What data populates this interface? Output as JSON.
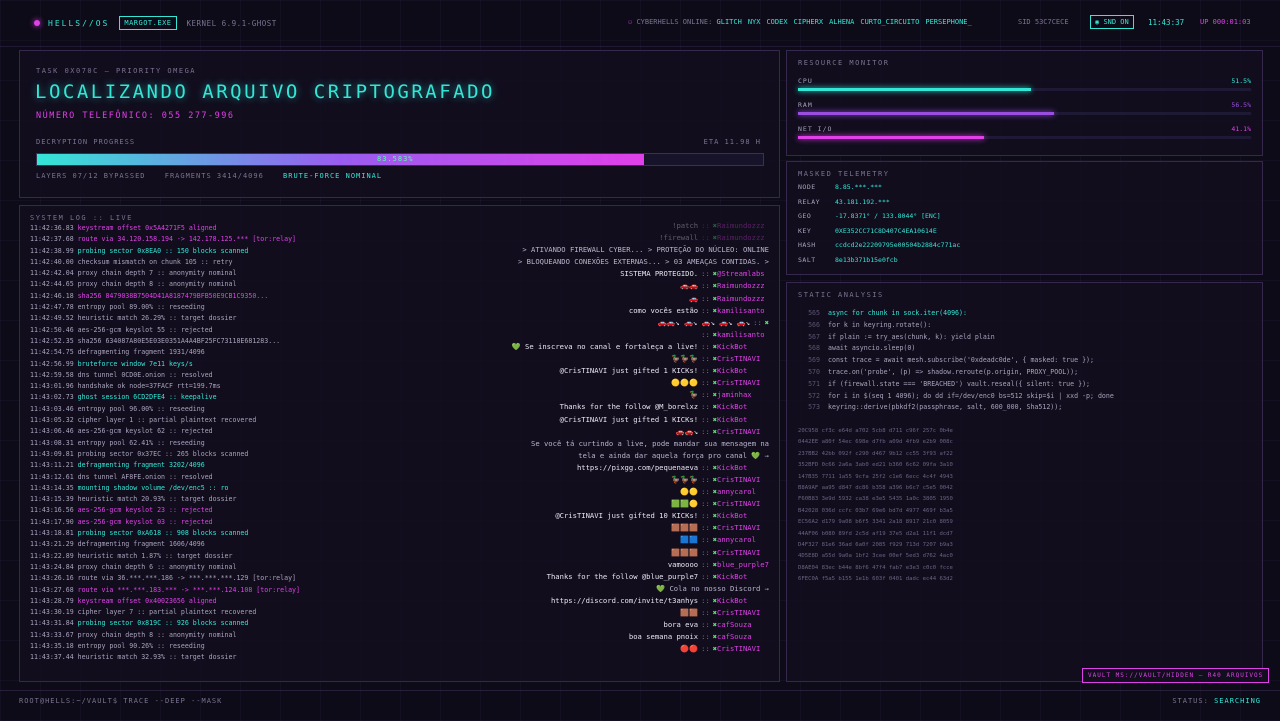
{
  "topbar": {
    "brand": "HELLS//OS",
    "process_badge": "MARGOT.EXE",
    "kernel": "KERNEL 6.9.1-GHOST",
    "online_label": "CYBERHELLS ONLINE:",
    "online_users": [
      "GLITCH",
      "NYX",
      "CODEX",
      "CIPHERX",
      "ALHENA",
      "CURTO_CIRCUITO",
      "PERSEPHONE_"
    ],
    "sid": "SID 53C7CECE",
    "snd_button": "SND ON",
    "clock": "11:43:37",
    "uptime": "UP 000:01:03"
  },
  "main": {
    "task": "TASK 0X070C — PRIORITY OMEGA",
    "headline": "LOCALIZANDO ARQUIVO CRIPTOGRAFADO",
    "phone": "NÚMERO TELEFÔNICO: 055 277-996",
    "progress_label": "DECRYPTION PROGRESS",
    "eta": "ETA 11.98 H",
    "progress_text": "83.583%",
    "progress_fraction": 0.836,
    "layers": "LAYERS 07/12 BYPASSED",
    "fragments": "FRAGMENTS 3414/4096",
    "status": "BRUTE-FORCE NOMINAL"
  },
  "log": {
    "title": "SYSTEM LOG :: LIVE",
    "lines": [
      {
        "t": "11:42:36.83",
        "msg": "keystream offset 0x5A4271F5 aligned",
        "color": "mag"
      },
      {
        "t": "11:42:37.68",
        "msg": "route via 34.120.158.194 -> 142.178.125.*** [tor:relay]",
        "color": "mag"
      },
      {
        "t": "11:42:38.99",
        "msg": "probing sector 0x8EA0 :: 150 blocks scanned",
        "color": "cyan"
      },
      {
        "t": "11:42:40.00",
        "msg": "checksum mismatch on chunk 105 :: retry",
        "color": ""
      },
      {
        "t": "11:42:42.04",
        "msg": "proxy chain depth 7 :: anonymity nominal",
        "color": ""
      },
      {
        "t": "11:42:44.65",
        "msg": "proxy chain depth 8 :: anonymity nominal",
        "color": ""
      },
      {
        "t": "11:42:46.18",
        "msg": "sha256 8479038B7504D41A8187479BFB50E9CB1C9350...",
        "color": "mag"
      },
      {
        "t": "11:42:47.78",
        "msg": "entropy pool 89.00% :: reseeding",
        "color": ""
      },
      {
        "t": "11:42:49.52",
        "msg": "heuristic match 26.29% :: target dossier",
        "color": ""
      },
      {
        "t": "11:42:50.46",
        "msg": "aes-256-gcm keyslot 55 :: rejected",
        "color": ""
      },
      {
        "t": "11:42:52.35",
        "msg": "sha256 634087A80E5E03E0351A4A4BF25FC73118E681283...",
        "color": ""
      },
      {
        "t": "11:42:54.75",
        "msg": "defragmenting fragment 1931/4096",
        "color": ""
      },
      {
        "t": "11:42:56.99",
        "msg": "bruteforce window 7e11 keys/s",
        "color": "cyan"
      },
      {
        "t": "11:42:59.58",
        "msg": "dns tunnel 0CD0E.onion :: resolved",
        "color": ""
      },
      {
        "t": "11:43:01.96",
        "msg": "handshake ok node=37FACF rtt=199.7ms",
        "color": ""
      },
      {
        "t": "11:43:02.73",
        "msg": "ghost session 6CD2DFE4 :: keepalive",
        "color": "cyan"
      },
      {
        "t": "11:43:03.46",
        "msg": "entropy pool 96.00% :: reseeding",
        "color": ""
      },
      {
        "t": "11:43:05.32",
        "msg": "cipher layer 1 :: partial plaintext recovered",
        "color": ""
      },
      {
        "t": "11:43:06.46",
        "msg": "aes-256-gcm keyslot 62 :: rejected",
        "color": ""
      },
      {
        "t": "11:43:08.31",
        "msg": "entropy pool 62.41% :: reseeding",
        "color": ""
      },
      {
        "t": "11:43:09.81",
        "msg": "probing sector 0x37EC :: 265 blocks scanned",
        "color": ""
      },
      {
        "t": "11:43:11.21",
        "msg": "defragmenting fragment 3202/4096",
        "color": "cyan"
      },
      {
        "t": "11:43:12.61",
        "msg": "dns tunnel AF8FE.onion :: resolved",
        "color": ""
      },
      {
        "t": "11:43:14.35",
        "msg": "mounting shadow volume /dev/enc5 :: ro",
        "color": "cyan"
      },
      {
        "t": "11:43:15.39",
        "msg": "heuristic match 20.93% :: target dossier",
        "color": ""
      },
      {
        "t": "11:43:16.56",
        "msg": "aes-256-gcm keyslot 23 :: rejected",
        "color": "mag"
      },
      {
        "t": "11:43:17.90",
        "msg": "aes-256-gcm keyslot 03 :: rejected",
        "color": "mag"
      },
      {
        "t": "11:43:18.81",
        "msg": "probing sector 0xA618 :: 908 blocks scanned",
        "color": "cyan"
      },
      {
        "t": "11:43:21.29",
        "msg": "defragmenting fragment 1606/4096",
        "color": ""
      },
      {
        "t": "11:43:22.89",
        "msg": "heuristic match 1.87% :: target dossier",
        "color": ""
      },
      {
        "t": "11:43:24.84",
        "msg": "proxy chain depth 6 :: anonymity nominal",
        "color": ""
      },
      {
        "t": "11:43:26.16",
        "msg": "route via 36.***.***.186 -> ***.***.***.129 [tor:relay]",
        "color": ""
      },
      {
        "t": "11:43:27.68",
        "msg": "route via ***.***.183.*** -> ***.***.124.108 [tor:relay]",
        "color": "mag"
      },
      {
        "t": "11:43:28.79",
        "msg": "keystream offset 0x40023656 aligned",
        "color": "mag"
      },
      {
        "t": "11:43:30.19",
        "msg": "cipher layer 7 :: partial plaintext recovered",
        "color": ""
      },
      {
        "t": "11:43:31.84",
        "msg": "probing sector 0x819C :: 926 blocks scanned",
        "color": "cyan"
      },
      {
        "t": "11:43:33.67",
        "msg": "proxy chain depth 8 :: anonymity nominal",
        "color": ""
      },
      {
        "t": "11:43:35.18",
        "msg": "entropy pool 90.26% :: reseeding",
        "color": ""
      },
      {
        "t": "11:43:37.44",
        "msg": "heuristic match 32.93% :: target dossier",
        "color": ""
      }
    ]
  },
  "chat": [
    {
      "text": "!patch",
      "user": "Raimundozzz",
      "faded": true
    },
    {
      "text": "!firewall",
      "user": "Raimundozzz",
      "faded": true
    },
    {
      "text": "> ATIVANDO FIREWALL CYBER... > PROTEÇÃO DO NÚCLEO: ONLINE",
      "user": "",
      "sys": true
    },
    {
      "text": "> BLOQUEANDO CONEXÕES EXTERNAS... > 03 AMEAÇAS CONTIDAS. >",
      "user": "",
      "sys": true
    },
    {
      "text": "SISTEMA PROTEGIDO.",
      "user": "@Streamlabs"
    },
    {
      "text": "🚗🚗",
      "user": "Raimundozzz"
    },
    {
      "text": "🚗",
      "user": "Raimundozzz"
    },
    {
      "text": "como vocês estão",
      "user": "kamilisanto"
    },
    {
      "text": "🚗🚗↘ 🚗↘ 🚗↘ 🚗↘ 🚗↘",
      "user": ""
    },
    {
      "text": "",
      "user": "kamilisanto"
    },
    {
      "text": "💚 Se inscreva no canal e fortaleça a live!",
      "user": "KickBot"
    },
    {
      "text": "🦆🦆🦆",
      "user": "CrisTINAVI"
    },
    {
      "text": "@CrisTINAVI just gifted 1 KICKs!",
      "user": "KickBot"
    },
    {
      "text": "🟡🟡🟡",
      "user": "CrisTINAVI"
    },
    {
      "text": "🦆",
      "user": "jaminhax"
    },
    {
      "text": "Thanks for the follow @M_borelxz",
      "user": "KickBot"
    },
    {
      "text": "@CrisTINAVI just gifted 1 KICKs!",
      "user": "KickBot"
    },
    {
      "text": "🚗🚗↘",
      "user": "CrisTINAVI"
    },
    {
      "text": "Se você tá curtindo a live, pode mandar sua mensagem na",
      "user": "",
      "sys": true
    },
    {
      "text": "tela e ainda dar aquela força pro canal 💚 →",
      "user": "",
      "sys": true
    },
    {
      "text": "https://pixgg.com/pequenaeva",
      "user": "KickBot"
    },
    {
      "text": "🦆🦆🦆",
      "user": "CrisTINAVI"
    },
    {
      "text": "🟡🟡",
      "user": "annycarol"
    },
    {
      "text": "🟩🟩🟡",
      "user": "CrisTINAVI"
    },
    {
      "text": "@CrisTINAVI just gifted 10 KICKs!",
      "user": "KickBot"
    },
    {
      "text": "🟫🟫🟫",
      "user": "CrisTINAVI"
    },
    {
      "text": "🟦🟦",
      "user": "annycarol"
    },
    {
      "text": "🟫🟫🟫",
      "user": "CrisTINAVI"
    },
    {
      "text": "vamoooo",
      "user": "blue_purple7"
    },
    {
      "text": "Thanks for the follow @blue_purple7",
      "user": "KickBot"
    },
    {
      "text": "💚 Cola no nosso Discord →",
      "user": "",
      "sys": true
    },
    {
      "text": "https://discord.com/invite/t3anhys",
      "user": "KickBot"
    },
    {
      "text": "🟫🟫",
      "user": "CrisTINAVI"
    },
    {
      "text": "bora eva",
      "user": "cafSouza"
    },
    {
      "text": "boa semana pnoix",
      "user": "cafSouza"
    },
    {
      "text": "🔴🔴",
      "user": "CrisTINAVI"
    }
  ],
  "resources": {
    "title": "RESOURCE MONITOR",
    "bars": [
      {
        "label": "CPU",
        "value": "51.5%",
        "fraction": 0.515,
        "color": "#33e6d5"
      },
      {
        "label": "RAM",
        "value": "56.5%",
        "fraction": 0.565,
        "color": "#9a4ee0"
      },
      {
        "label": "NET I/O",
        "value": "41.1%",
        "fraction": 0.411,
        "color": "#e040e8"
      }
    ]
  },
  "telemetry": {
    "title": "MASKED TELEMETRY",
    "rows": [
      {
        "k": "NODE",
        "v": "8.85.***.***"
      },
      {
        "k": "RELAY",
        "v": "43.181.192.***"
      },
      {
        "k": "GEO",
        "v": "-17.8371° / 133.8044° [ENC]"
      },
      {
        "k": "KEY",
        "v": "0XE352CC71C8D407C4EA10614E"
      },
      {
        "k": "HASH",
        "v": "ccdcd2e22209795e00504b2884c771ac"
      },
      {
        "k": "SALT",
        "v": "8e13b371b15e0fcb"
      }
    ]
  },
  "static": {
    "title": "STATIC ANALYSIS",
    "code": [
      {
        "ln": "565",
        "src": "async for chunk in sock.iter(4096):",
        "hl": true
      },
      {
        "ln": "566",
        "src": "for k in keyring.rotate():",
        "hl": false
      },
      {
        "ln": "567",
        "src": "if plain := try_aes(chunk, k): yield plain",
        "hl": false
      },
      {
        "ln": "568",
        "src": "await asyncio.sleep(0)",
        "hl": false
      },
      {
        "ln": "569",
        "src": "const trace = await mesh.subscribe('0xdeadc0de', { masked: true });",
        "hl": false
      },
      {
        "ln": "570",
        "src": "trace.on('probe', (p) => shadow.reroute(p.origin, PROXY_POOL));",
        "hl": false
      },
      {
        "ln": "571",
        "src": "if (firewall.state === 'BREACHED') vault.reseal({ silent: true });",
        "hl": false
      },
      {
        "ln": "572",
        "src": "for i in $(seq 1 4096); do dd if=/dev/enc0 bs=512 skip=$i | xxd -p; done",
        "hl": false
      },
      {
        "ln": "573",
        "src": "keyring::derive(pbkdf2(passphrase, salt, 600_000, Sha512));",
        "hl": false
      }
    ],
    "hexdump": [
      "20C958 cf3c e64d a702 5cb8 d711 c96f 257c 0b4e",
      "0442EE a80f 54ec 698e d7fb a09d 4fb9 e2b9 008c",
      "237BB2 42bb 092f c290 d467 9b12 cc55 3f93 af22",
      "352BFD 0c66 2a6a 3ab0 ed21 b360 6c62 09fa 3a10",
      "147B35 7711 1a55 9cfa 25f2 c1e6 6ecc 4c4f 4943",
      "B8A9AF aa95 d847 dc86 b358 a396 b6c7 c5e5 0042",
      "F60B83 3e9d 5932 ca38 e3e5 5435 1a0c 3805 1950",
      "B42028 036d ccfc 03b7 69e6 bd7d 4977 469f b3a5",
      "EC56A2 d179 9a08 b6f5 3341 2a18 8917 21c0 8059",
      "44AF06 b080 89fd 2c5d af19 37e5 d2a1 11f1 dcd7",
      "D4F327 81e6 36ad 6a0f 2085 f929 713d 7207 b9a3",
      "4D5E8D a55d 9a0a 1bf2 3cee 00ef 5ed3 d762 4ac0",
      "D8AE04 83ec b44e 8bf6 47f4 fab7 e3e3 c0c0 fcce",
      "6FEC0A f5a5 b155 1e1b 603f 0401 dadc ec44 63d2"
    ]
  },
  "vault": "VAULT MS://VAULT/HIDDEN — R40 ARQUIVOS",
  "bottom": {
    "command": "ROOT@HELLS:~/VAULT$ TRACE --DEEP --MASK",
    "status_label": "STATUS:",
    "status_value": "SEARCHING"
  }
}
